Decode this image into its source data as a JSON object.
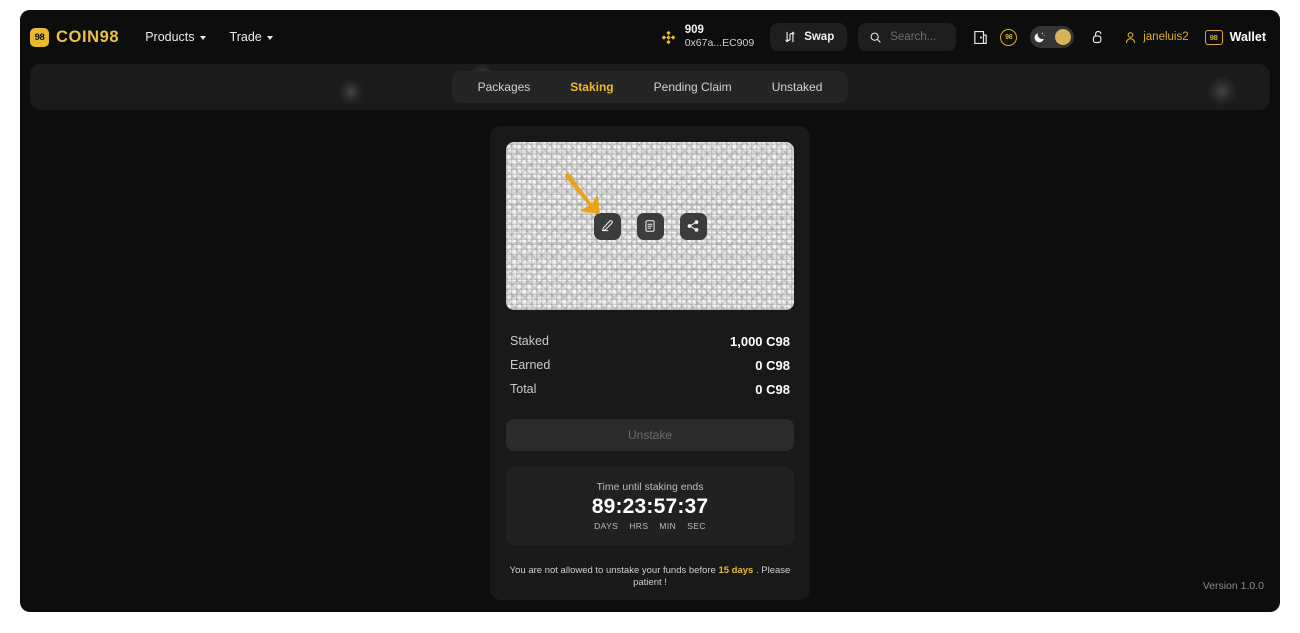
{
  "header": {
    "brand_mark": "98",
    "brand_name": "COIN98",
    "nav": [
      {
        "label": "Products",
        "icon": "chevron-down-icon"
      },
      {
        "label": "Trade",
        "icon": "chevron-down-icon"
      }
    ],
    "network": {
      "icon": "binance-diamond-icon",
      "name": "909",
      "address": "0x67a...EC909"
    },
    "swap": {
      "icon": "swap-icon",
      "label": "Swap"
    },
    "search": {
      "icon": "search-icon",
      "placeholder": "Search..."
    },
    "book_icon": "book-icon",
    "points_badge": "98",
    "theme_toggle": {
      "moon_icon": "moon-icon",
      "knob_icon": "sun-icon"
    },
    "unlock_icon": "unlock-icon",
    "user": {
      "icon": "person-icon",
      "name": "janeluis2"
    },
    "wallet": {
      "badge": "98",
      "label": "Wallet"
    }
  },
  "tabs": [
    {
      "label": "Packages",
      "active": false
    },
    {
      "label": "Staking",
      "active": true
    },
    {
      "label": "Pending Claim",
      "active": false
    },
    {
      "label": "Unstaked",
      "active": false
    }
  ],
  "stake_card": {
    "nft_actions": [
      {
        "icon": "edit-pencil-icon",
        "name": "edit"
      },
      {
        "icon": "document-icon",
        "name": "details"
      },
      {
        "icon": "share-icon",
        "name": "share"
      }
    ],
    "annotation": {
      "icon": "arrow-pointer-icon",
      "color": "#E8A317"
    },
    "stats": [
      {
        "label": "Staked",
        "value": "1,000 C98"
      },
      {
        "label": "Earned",
        "value": "0 C98"
      },
      {
        "label": "Total",
        "value": "0 C98"
      }
    ],
    "unstake_label": "Unstake",
    "countdown": {
      "title": "Time until staking ends",
      "time": "89:23:57:37",
      "units": [
        "DAYS",
        "HRS",
        "MIN",
        "SEC"
      ]
    },
    "warning": {
      "prefix": "You are not allowed to unstake your funds before ",
      "highlight": "15 days",
      "suffix": " . Please patient !"
    }
  },
  "footer": {
    "version": "Version 1.0.0"
  },
  "colors": {
    "accent_gold": "#E8B931",
    "page_bg": "#0D0D0D",
    "card_bg": "#191919"
  }
}
